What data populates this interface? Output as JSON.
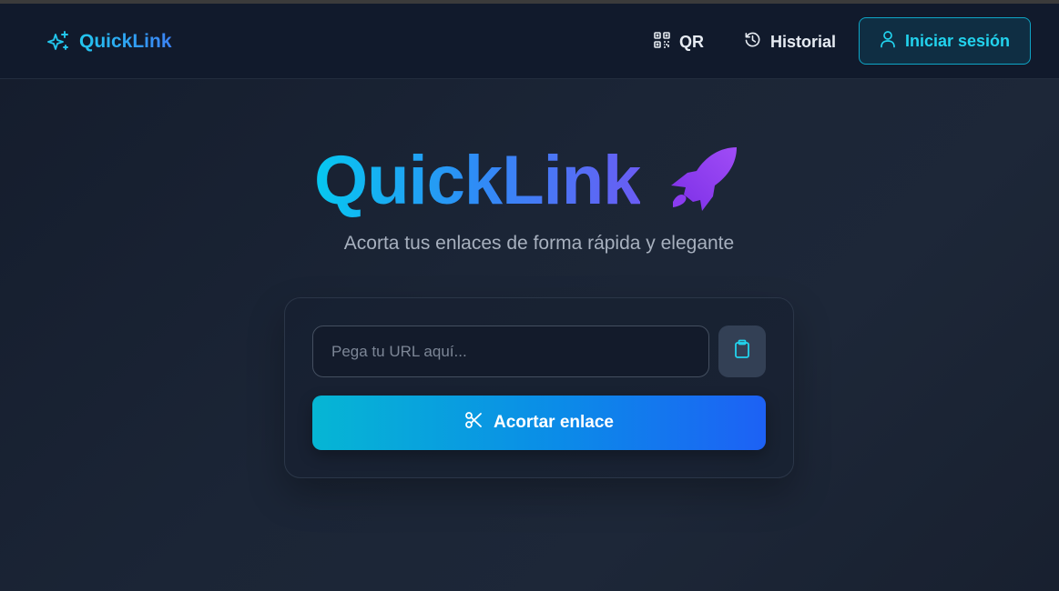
{
  "brand": {
    "name": "QuickLink",
    "icon": "sparkles-icon",
    "color": "#22c7ee"
  },
  "nav": {
    "qr_label": "QR",
    "history_label": "Historial",
    "login_label": "Iniciar sesión"
  },
  "hero": {
    "title": "QuickLink",
    "icon": "rocket-icon",
    "subtitle": "Acorta tus enlaces de forma rápida y elegante"
  },
  "form": {
    "url_placeholder": "Pega tu URL aquí...",
    "url_value": "",
    "paste_icon": "clipboard-icon",
    "submit_label": "Acortar enlace",
    "submit_icon": "scissors-icon"
  },
  "colors": {
    "accent": "#22d3ee",
    "button_gradient_start": "#06b6d4",
    "button_gradient_end": "#1d61f5",
    "rocket": "#8b3cf0"
  }
}
